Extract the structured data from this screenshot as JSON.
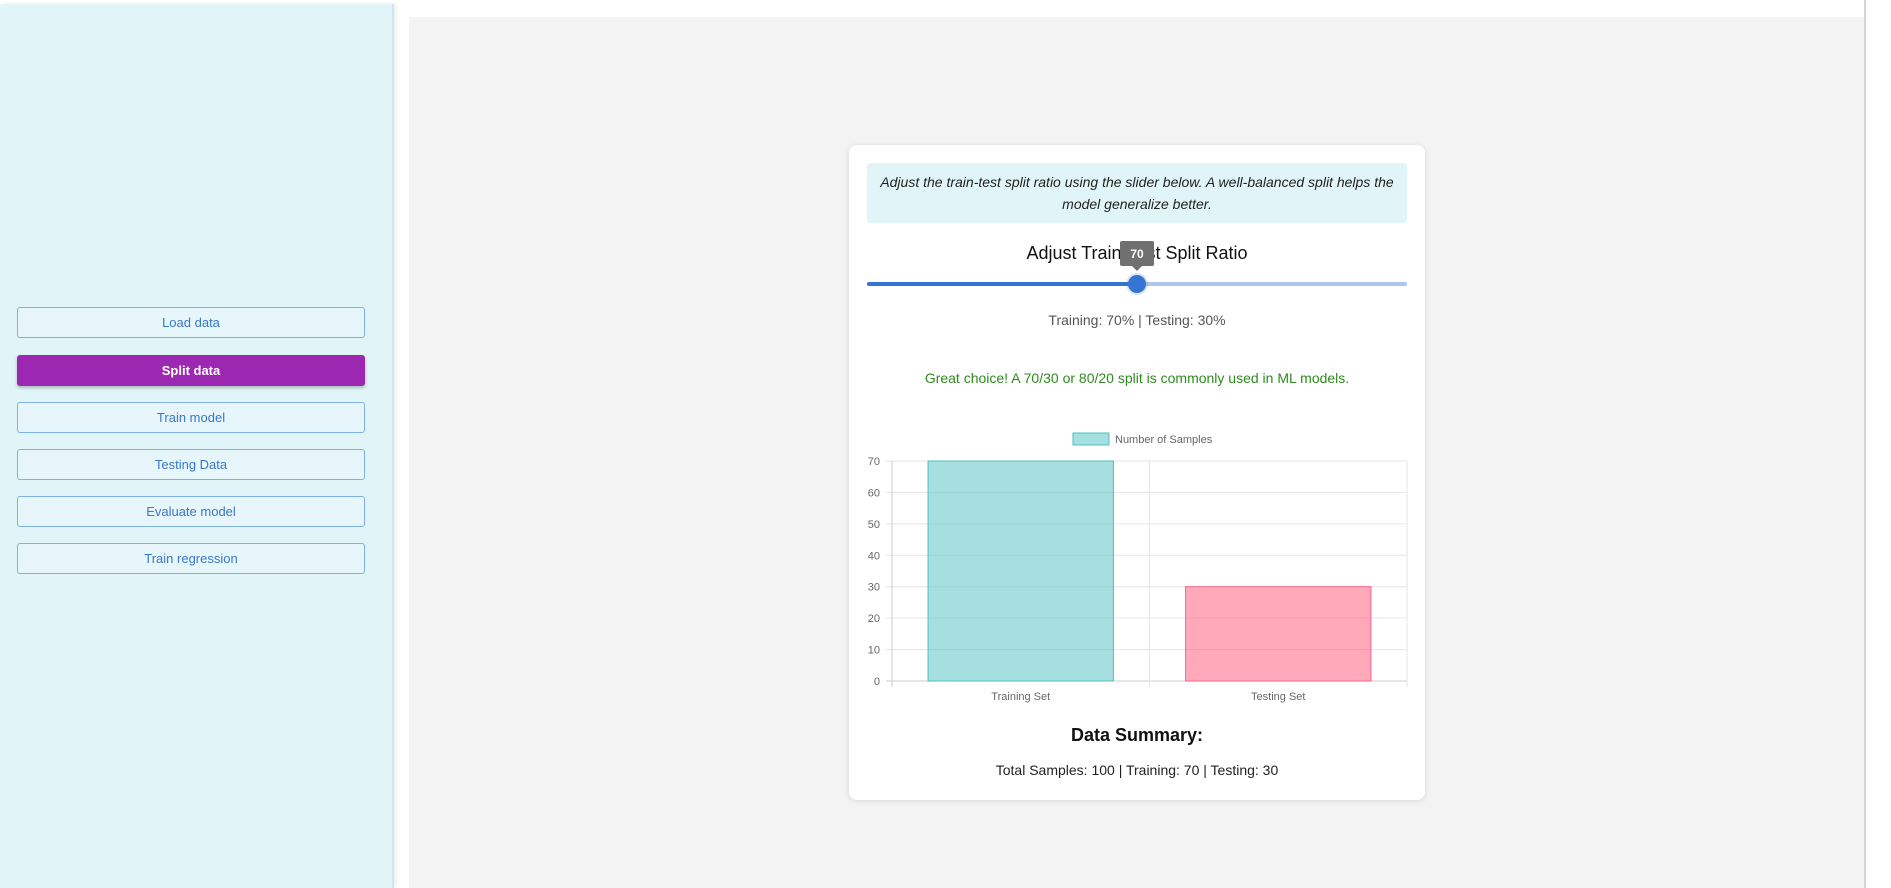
{
  "sidebar": {
    "items": [
      {
        "label": "Load data",
        "active": false
      },
      {
        "label": "Split data",
        "active": true
      },
      {
        "label": "Train model",
        "active": false
      },
      {
        "label": "Testing Data",
        "active": false
      },
      {
        "label": "Evaluate model",
        "active": false
      },
      {
        "label": "Train regression",
        "active": false
      }
    ]
  },
  "card": {
    "info": "Adjust the train-test split ratio using the slider below. A well-balanced split helps the model generalize better.",
    "slider_title": "Adjust Train-Test Split Ratio",
    "slider_value": "70",
    "slider_fraction": 0.5,
    "ratio_text": "Training: 70% | Testing: 30%",
    "feedback": "Great choice! A 70/30 or 80/20 split is commonly used in ML models.",
    "summary_title": "Data Summary:",
    "summary_text": "Total Samples: 100 | Training: 70 | Testing: 30"
  },
  "colors": {
    "accent": "#3574d0",
    "active_nav": "#9c27b0",
    "sidebar_bg": "#e1f5f9",
    "training_fill": "rgba(75,192,192,0.5)",
    "training_stroke": "#4bc0c0",
    "testing_fill": "rgba(255,99,132,0.55)",
    "testing_stroke": "#ff6384"
  },
  "chart_data": {
    "type": "bar",
    "categories": [
      "Training Set",
      "Testing Set"
    ],
    "series": [
      {
        "name": "Number of Samples",
        "values": [
          70,
          30
        ]
      }
    ],
    "ylim": [
      0,
      70
    ],
    "yticks": [
      0,
      10,
      20,
      30,
      40,
      50,
      60,
      70
    ],
    "legend": "top-center",
    "grid": true
  }
}
